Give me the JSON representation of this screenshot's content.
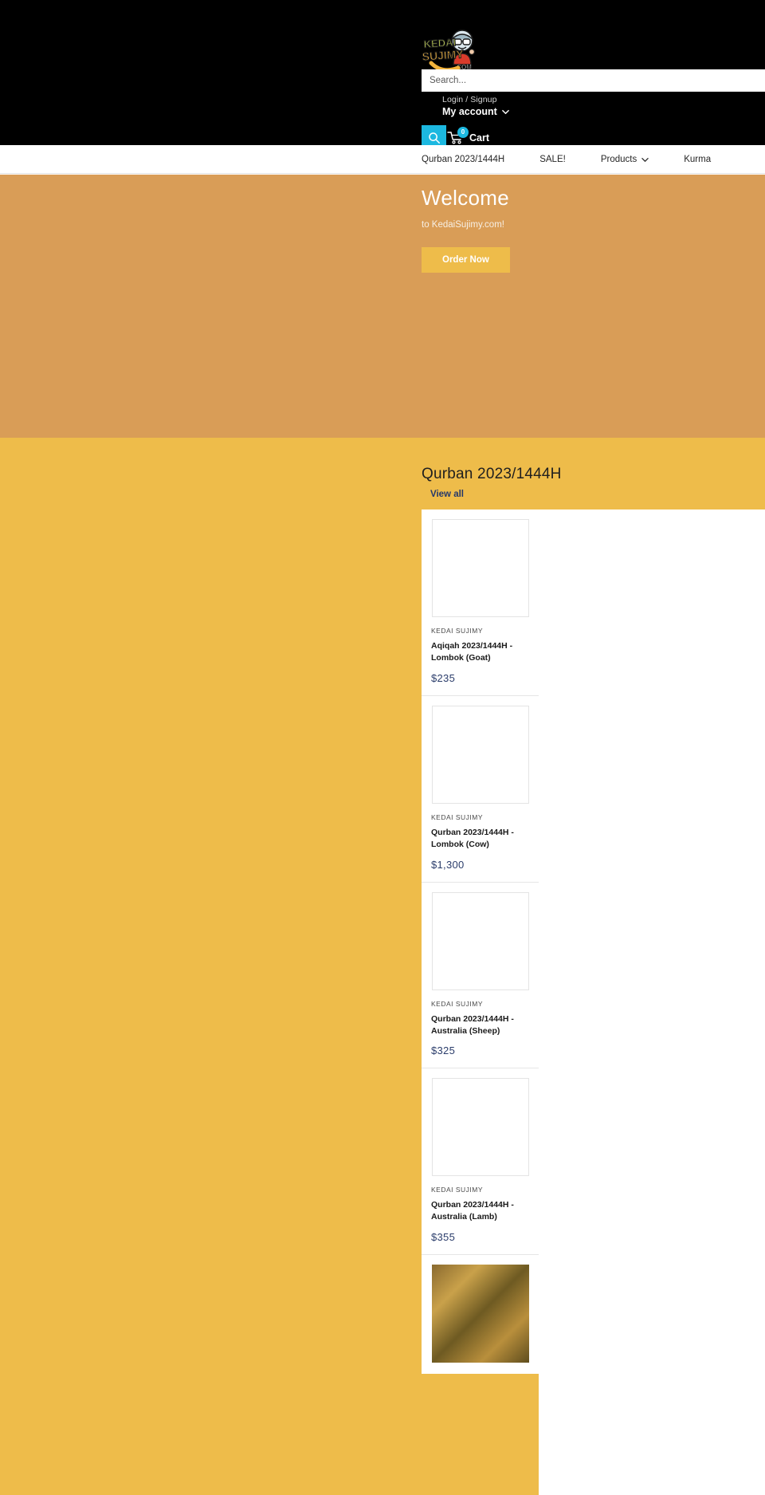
{
  "brand": {
    "logo_text_line1": "KEDAI",
    "logo_text_line2": "SUJIMY",
    "logo_text_line3": ".COM",
    "accent_cyan": "#1cb8e0",
    "hero_bg": "#d99d57",
    "section_bg": "#eebc4a",
    "button_gold": "#eebc4a"
  },
  "search": {
    "placeholder": "Search...",
    "icon": "search-icon"
  },
  "account": {
    "login_label": "Login / Signup",
    "account_label": "My account",
    "chevron_icon": "chevron-down-icon"
  },
  "cart": {
    "icon": "cart-icon",
    "count": "0",
    "label": "Cart"
  },
  "nav": {
    "items": [
      {
        "label": "Qurban 2023/1444H",
        "has_dropdown": false
      },
      {
        "label": "SALE!",
        "has_dropdown": false
      },
      {
        "label": "Products",
        "has_dropdown": true,
        "icon": "chevron-down-icon"
      },
      {
        "label": "Kurma",
        "has_dropdown": false
      }
    ]
  },
  "hero": {
    "title": "Welcome",
    "subtitle": "to KedaiSujimy.com!",
    "button_label": "Order Now"
  },
  "section": {
    "title": "Qurban 2023/1444H",
    "view_all_label": "View all",
    "products": [
      {
        "vendor": "KEDAI SUJIMY",
        "name": "Aqiqah 2023/1444H - Lombok (Goat)",
        "price": "$235",
        "image": "placeholder"
      },
      {
        "vendor": "KEDAI SUJIMY",
        "name": "Qurban 2023/1444H - Lombok (Cow)",
        "price": "$1,300",
        "image": "placeholder"
      },
      {
        "vendor": "KEDAI SUJIMY",
        "name": "Qurban 2023/1444H - Australia (Sheep)",
        "price": "$325",
        "image": "placeholder"
      },
      {
        "vendor": "KEDAI SUJIMY",
        "name": "Qurban 2023/1444H - Australia (Lamb)",
        "price": "$355",
        "image": "placeholder"
      },
      {
        "vendor": "",
        "name": "",
        "price": "",
        "image": "photo"
      }
    ]
  }
}
